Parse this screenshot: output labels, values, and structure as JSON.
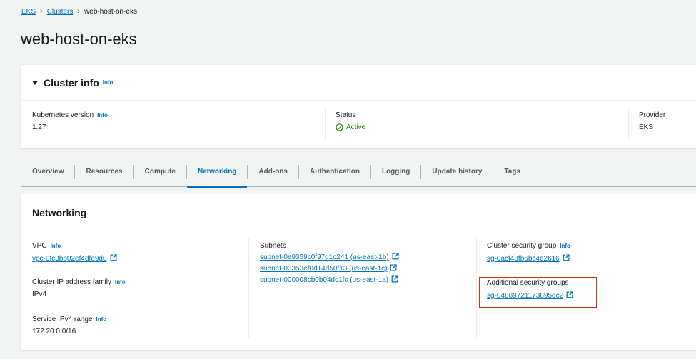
{
  "breadcrumb": {
    "eks": "EKS",
    "clusters": "Clusters",
    "current": "web-host-on-eks"
  },
  "page_title": "web-host-on-eks",
  "info_label": "Info",
  "cluster_info": {
    "title": "Cluster info",
    "kubernetes_version_label": "Kubernetes version",
    "kubernetes_version": "1.27",
    "status_label": "Status",
    "status": "Active",
    "provider_label": "Provider",
    "provider": "EKS"
  },
  "tabs": [
    "Overview",
    "Resources",
    "Compute",
    "Networking",
    "Add-ons",
    "Authentication",
    "Logging",
    "Update history",
    "Tags"
  ],
  "active_tab": "Networking",
  "networking": {
    "title": "Networking",
    "vpc_label": "VPC",
    "vpc": "vpc-0fc3bb02ef4dfe9d0",
    "ip_family_label": "Cluster IP address family",
    "ip_family": "IPv4",
    "service_range_label": "Service IPv4 range",
    "service_range": "172.20.0.0/16",
    "subnets_label": "Subnets",
    "subnets": [
      "subnet-0e9359c0f97d1c241 (us-east-1b)",
      "subnet-03353ef0d14d50f13 (us-east-1c)",
      "subnet-000008cb0b04dc1fc (us-east-1a)"
    ],
    "cluster_sg_label": "Cluster security group",
    "cluster_sg": "sg-0acf48fb6bc4e2616",
    "additional_sg_label": "Additional security groups",
    "additional_sg": "sg-04889721173895dc2"
  },
  "colors": {
    "link": "#0073bb",
    "active_status": "#1d8102",
    "highlight": "#d13212"
  }
}
